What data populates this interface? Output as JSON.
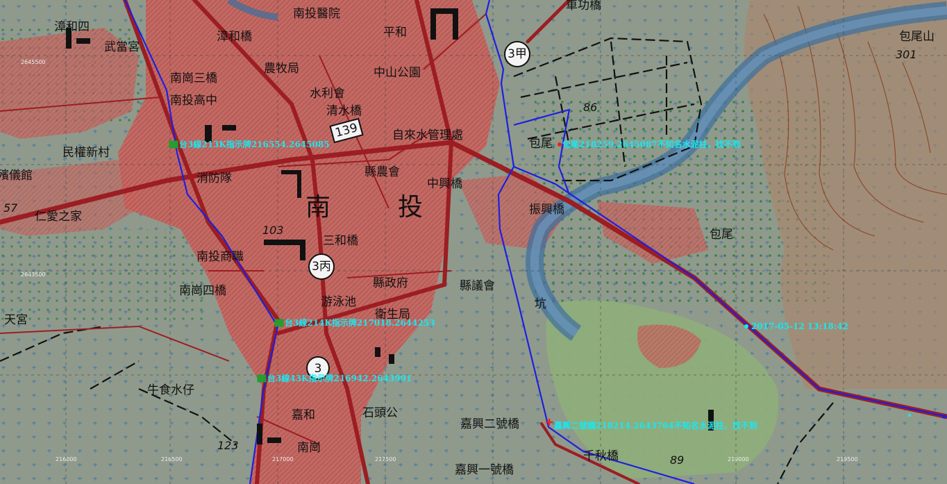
{
  "places": [
    {
      "id": "nantou-hospital",
      "label": "南投醫院"
    },
    {
      "id": "zhanghe-east",
      "label": "漳和四"
    },
    {
      "id": "zhanghe-bridge",
      "label": "漳和橋"
    },
    {
      "id": "pinghe",
      "label": "平和"
    },
    {
      "id": "chegong-bridge",
      "label": "車功橋"
    },
    {
      "id": "wudang-temple",
      "label": "武當宮"
    },
    {
      "id": "nangang-bridge3",
      "label": "南崗三橋"
    },
    {
      "id": "nongmu",
      "label": "農牧局"
    },
    {
      "id": "zhongshan-park",
      "label": "中山公園"
    },
    {
      "id": "nantou-high",
      "label": "南投高中"
    },
    {
      "id": "water-assoc",
      "label": "水利會"
    },
    {
      "id": "qingshui-bridge",
      "label": "清水橋"
    },
    {
      "id": "water-admin",
      "label": "自來水管理處"
    },
    {
      "id": "minquan",
      "label": "民權新村"
    },
    {
      "id": "fire-brigade",
      "label": "消防隊"
    },
    {
      "id": "county-farm",
      "label": "縣農會"
    },
    {
      "id": "zhongxing-bridge",
      "label": "中興橋"
    },
    {
      "id": "baowei-1",
      "label": "包尾"
    },
    {
      "id": "zhenxing-bridge",
      "label": "振興橋"
    },
    {
      "id": "baowei-2",
      "label": "包尾"
    },
    {
      "id": "baowei-mt",
      "label": "包尾山"
    },
    {
      "id": "ceremony-hall",
      "label": "殯儀館"
    },
    {
      "id": "renai",
      "label": "仁愛之家"
    },
    {
      "id": "nan",
      "label": "南"
    },
    {
      "id": "tou",
      "label": "投"
    },
    {
      "id": "sanhe-bridge",
      "label": "三和橋"
    },
    {
      "id": "nantou-voc",
      "label": "南投商職"
    },
    {
      "id": "county-gov",
      "label": "縣政府"
    },
    {
      "id": "county-council",
      "label": "縣議會"
    },
    {
      "id": "nangang-bridge4",
      "label": "南崗四橋"
    },
    {
      "id": "pool",
      "label": "游泳池"
    },
    {
      "id": "health-bureau",
      "label": "衛生局"
    },
    {
      "id": "keng",
      "label": "坑"
    },
    {
      "id": "tiangong",
      "label": "天宮"
    },
    {
      "id": "niushi",
      "label": "牛食水仔"
    },
    {
      "id": "jiahe",
      "label": "嘉和"
    },
    {
      "id": "shitougong",
      "label": "石頭公"
    },
    {
      "id": "jiaxing2-bridge",
      "label": "嘉興二號橋"
    },
    {
      "id": "nangang",
      "label": "南崗"
    },
    {
      "id": "jiaxing1-bridge",
      "label": "嘉興一號橋"
    },
    {
      "id": "qianqiu-bridge",
      "label": "千秋橋"
    }
  ],
  "road_shields": [
    {
      "id": "r3li",
      "label": "3甲"
    },
    {
      "id": "r139",
      "label": "139"
    },
    {
      "id": "r3bing",
      "label": "3丙"
    },
    {
      "id": "r3",
      "label": "3"
    }
  ],
  "elevations": [
    {
      "id": "e86",
      "label": "86"
    },
    {
      "id": "e103",
      "label": "103"
    },
    {
      "id": "e57",
      "label": "57"
    },
    {
      "id": "e123",
      "label": "123"
    },
    {
      "id": "e89",
      "label": "89"
    },
    {
      "id": "e301",
      "label": "301"
    }
  ],
  "grid_labels": [
    {
      "id": "g1",
      "label": "2645500"
    },
    {
      "id": "g2",
      "label": "2643500"
    },
    {
      "id": "g3",
      "label": "216000"
    },
    {
      "id": "g4",
      "label": "216500"
    },
    {
      "id": "g5",
      "label": "217000"
    },
    {
      "id": "g6",
      "label": "217500"
    },
    {
      "id": "g7",
      "label": "219000"
    },
    {
      "id": "g8",
      "label": "219500"
    }
  ],
  "waypoints": [
    {
      "id": "wp1",
      "label": "台3線213K指示牌216554.2645085",
      "color": "#19e8f0"
    },
    {
      "id": "wp2",
      "label": "包尾218259.2645087不知名水泥柱，找不到",
      "color": "#19e8f0"
    },
    {
      "id": "wp3",
      "label": "台3線214K指示牌217018.2644253",
      "color": "#19e8f0"
    },
    {
      "id": "wp4",
      "label": "2017-05-12 13:18:42",
      "color": "#19e8f0"
    },
    {
      "id": "wp5",
      "label": "台3線43K指示牌216942.2643991",
      "color": "#19e8f0"
    },
    {
      "id": "wp6",
      "label": "嘉興二號橋218214.2643764不知名水泥柱，找不到",
      "color": "#19e8f0"
    }
  ],
  "colors": {
    "background": "#8f9a8c",
    "urban": "#c8625e",
    "main_road": "#9c1d22",
    "river": "#3a6fa0",
    "track": "#1f1fe0",
    "waypoint_text": "#19e8f0",
    "contour": "#9c5b3c",
    "field": "#8fae7a"
  }
}
